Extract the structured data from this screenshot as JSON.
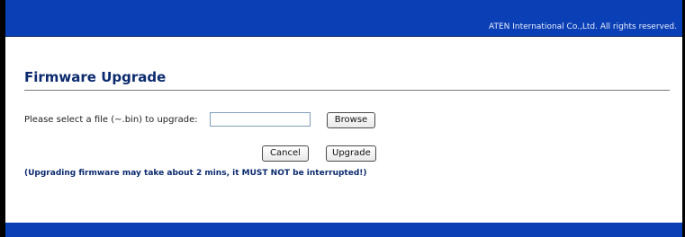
{
  "header": {
    "copyright": "ATEN International Co.,Ltd. All rights reserved."
  },
  "main": {
    "title": "Firmware Upgrade",
    "file_label": "Please select a file (~.bin) to upgrade:",
    "file_value": "",
    "browse_label": "Browse",
    "cancel_label": "Cancel",
    "upgrade_label": "Upgrade",
    "warning": "(Upgrading firmware may take about 2 mins, it MUST NOT be interrupted!)"
  },
  "colors": {
    "bar_blue": "#0a3fb6",
    "title_navy": "#0b2a6e"
  }
}
